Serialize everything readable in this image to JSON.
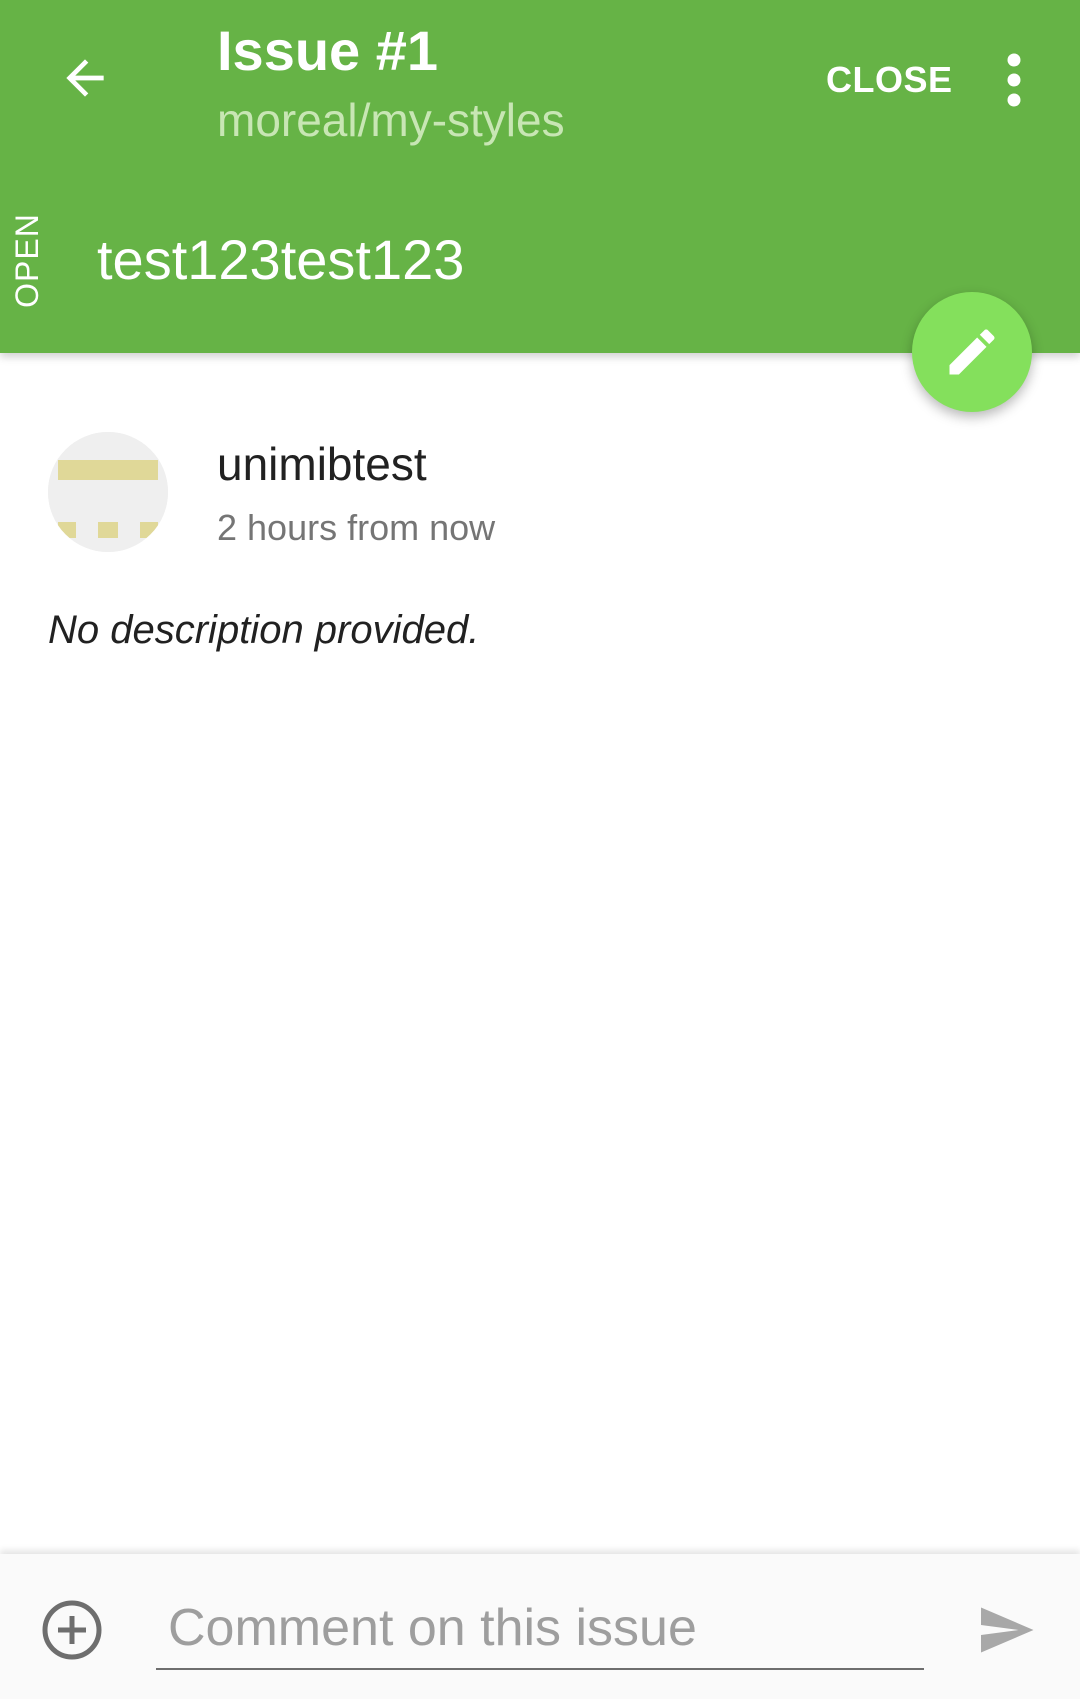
{
  "header": {
    "title": "Issue #1",
    "subtitle": "moreal/my-styles",
    "close_label": "CLOSE",
    "status": "OPEN",
    "issue_title": "test123test123",
    "back_icon": "arrow-back-icon",
    "more_icon": "more-vert-icon",
    "color": "#66b346"
  },
  "fab": {
    "icon": "edit-pencil-icon",
    "color": "#84e05c"
  },
  "issue": {
    "author": "unimibtest",
    "time": "2 hours from now",
    "description": "No description provided.",
    "avatar_color": "#e0d898"
  },
  "comment_bar": {
    "placeholder": "Comment on this issue",
    "attach_icon": "add-circle-icon",
    "send_icon": "send-icon"
  }
}
